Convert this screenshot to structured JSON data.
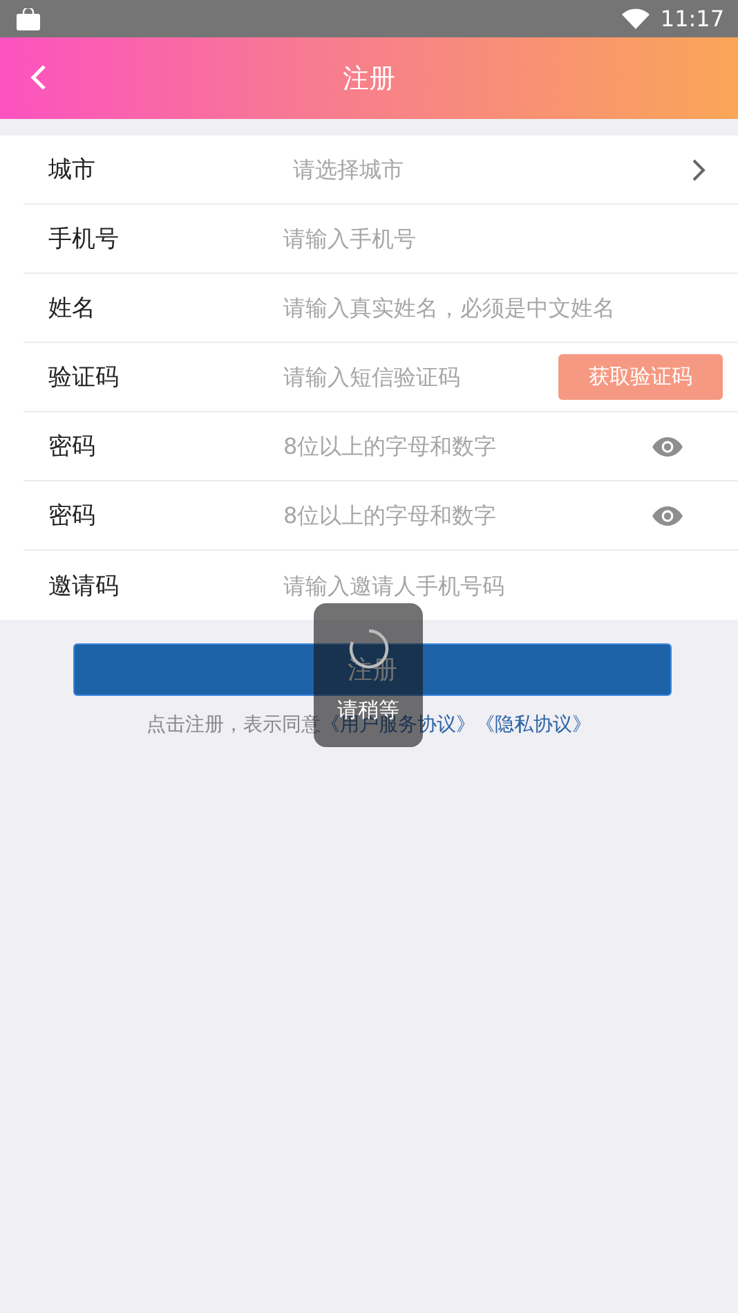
{
  "status_bar": {
    "time": "11:17"
  },
  "header": {
    "title": "注册"
  },
  "form": {
    "rows": [
      {
        "kind": "select",
        "label": "城市",
        "placeholder": "请选择城市"
      },
      {
        "kind": "text",
        "label": "手机号",
        "placeholder": "请输入手机号"
      },
      {
        "kind": "text",
        "label": "姓名",
        "placeholder": "请输入真实姓名，必须是中文姓名"
      },
      {
        "kind": "code",
        "label": "验证码",
        "placeholder": "请输入短信验证码",
        "action": "获取验证码"
      },
      {
        "kind": "password",
        "label": "密码",
        "placeholder": "8位以上的字母和数字"
      },
      {
        "kind": "password",
        "label": "密码",
        "placeholder": "8位以上的字母和数字"
      },
      {
        "kind": "text",
        "label": "邀请码",
        "placeholder": "请输入邀请人手机号码"
      }
    ]
  },
  "submit": {
    "label": "注册"
  },
  "agreement": {
    "text": "点击注册，表示同意",
    "links": [
      "《用户服务协议》",
      "《隐私协议》"
    ]
  },
  "loading": {
    "message": "请稍等"
  }
}
